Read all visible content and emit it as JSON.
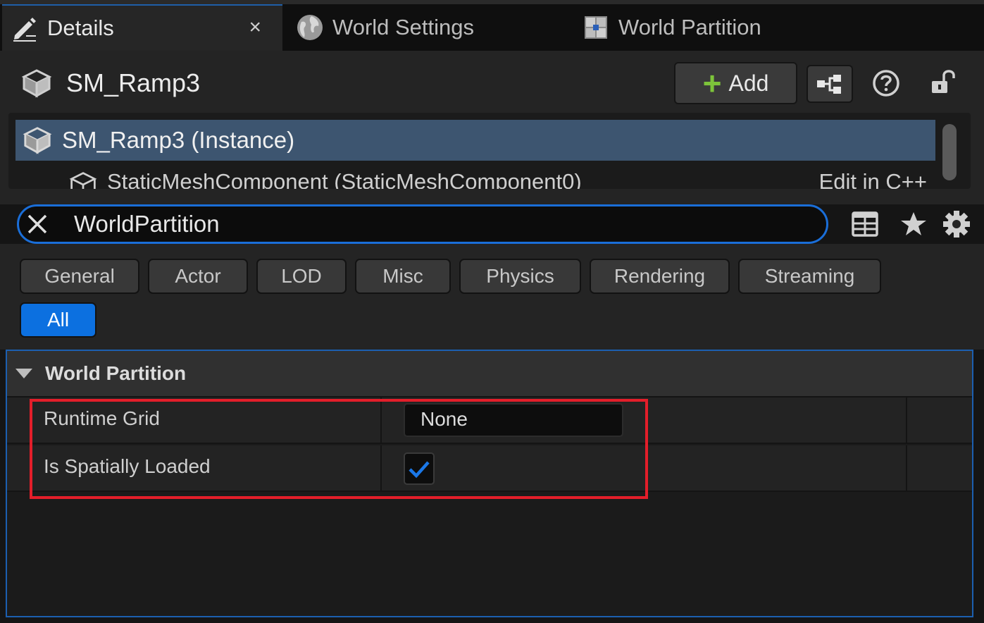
{
  "tabs": [
    {
      "label": "Details",
      "close": "×",
      "active": true
    },
    {
      "label": "World Settings",
      "active": false
    },
    {
      "label": "World Partition",
      "active": false
    }
  ],
  "header": {
    "actor_name": "SM_Ramp3",
    "add_label": "Add",
    "add_symbol": "+"
  },
  "tree": {
    "selected": "SM_Ramp3 (Instance)",
    "component": "StaticMeshComponent (StaticMeshComponent0)",
    "component_action": "Edit in C++"
  },
  "search": {
    "value": "WorldPartition"
  },
  "categories": [
    {
      "label": "General",
      "selected": false
    },
    {
      "label": "Actor",
      "selected": false
    },
    {
      "label": "LOD",
      "selected": false
    },
    {
      "label": "Misc",
      "selected": false
    },
    {
      "label": "Physics",
      "selected": false
    },
    {
      "label": "Rendering",
      "selected": false
    },
    {
      "label": "Streaming",
      "selected": false
    },
    {
      "label": "All",
      "selected": true
    }
  ],
  "section": {
    "title": "World Partition",
    "properties": [
      {
        "label": "Runtime Grid",
        "value": "None"
      },
      {
        "label": "Is Spatially Loaded",
        "checked": true
      }
    ]
  },
  "colors": {
    "accent_blue": "#0c70e0",
    "selection_blue": "#3d5570",
    "add_green": "#7dc43a",
    "highlight_red": "#e31e2a"
  },
  "icons": [
    "details-pencil-icon",
    "close-icon",
    "globe-icon",
    "world-partition-icon",
    "mesh-cube-icon",
    "blueprint-icon",
    "help-icon",
    "unlock-icon",
    "clear-search-icon",
    "table-view-icon",
    "favorite-star-icon",
    "settings-gear-icon",
    "checkmark-icon"
  ]
}
